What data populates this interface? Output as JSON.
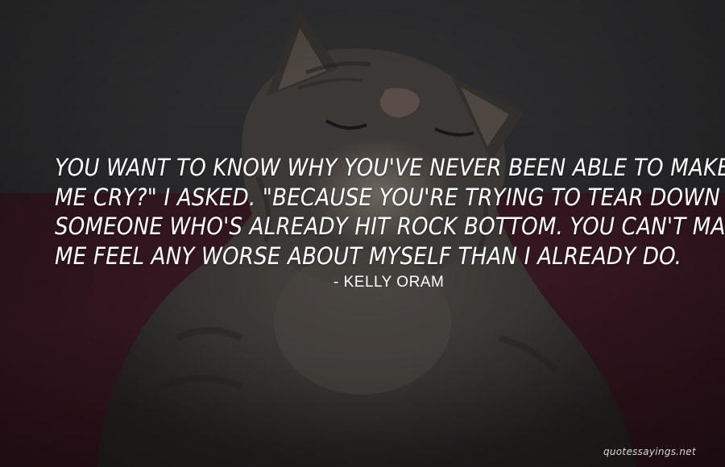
{
  "quote": {
    "lines": [
      "You want to know why you've never been able to make",
      "me cry?\" I asked. \"Because you're trying to tear down",
      "someone who's already hit rock bottom. You can't make",
      "me feel any worse about myself than I already do."
    ]
  },
  "author": "- Kelly Oram",
  "watermark": "quotessayings.net",
  "colors": {
    "text": "#ffffff",
    "wall": "#333336",
    "blanket": "#421d2a"
  }
}
